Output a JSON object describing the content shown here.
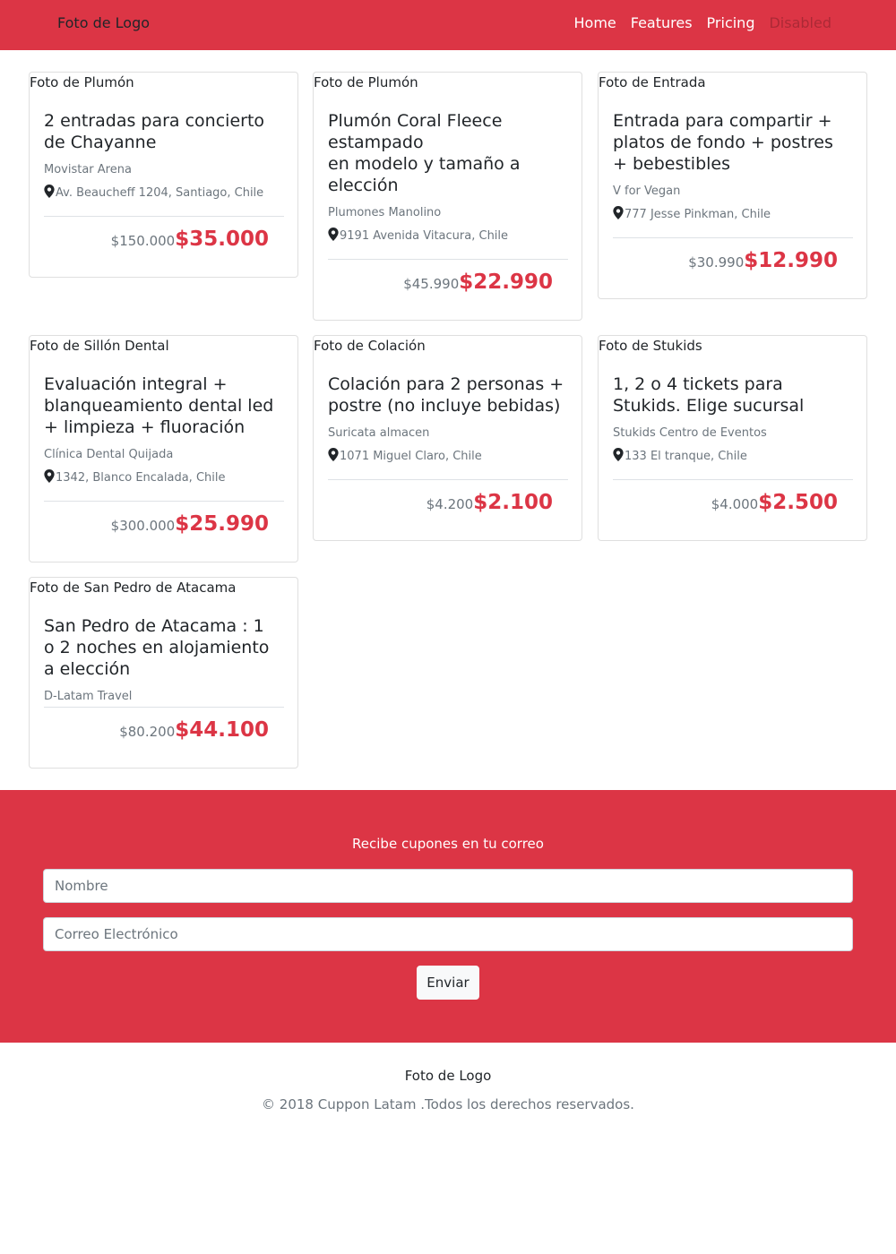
{
  "navbar": {
    "brand": "Foto de Logo",
    "links": [
      {
        "label": "Home"
      },
      {
        "label": "Features"
      },
      {
        "label": "Pricing"
      },
      {
        "label": "Disabled"
      }
    ]
  },
  "deals": [
    {
      "image_alt": "Foto de Plumón",
      "title": "2 entradas para concierto de Chayanne",
      "merchant": "Movistar Arena",
      "address": "Av. Beaucheff 1204, Santiago, Chile",
      "old_price": "$150.000",
      "new_price": "$35.000"
    },
    {
      "image_alt": "Foto de Plumón",
      "title": "Plumón Coral Fleece estampado\nen modelo y tamaño a elección",
      "merchant": "Plumones Manolino",
      "address": "9191 Avenida Vitacura, Chile",
      "old_price": "$45.990",
      "new_price": "$22.990"
    },
    {
      "image_alt": "Foto de Entrada",
      "title": "Entrada para compartir + platos de fondo + postres + bebestibles",
      "merchant": "V for Vegan",
      "address": "777 Jesse Pinkman, Chile",
      "old_price": "$30.990",
      "new_price": "$12.990"
    },
    {
      "image_alt": "Foto de Sillón Dental",
      "title": "Evaluación integral + blanqueamiento dental led + limpieza + fluoración",
      "merchant": "Clínica Dental Quijada",
      "address": "1342, Blanco Encalada, Chile",
      "old_price": "$300.000",
      "new_price": "$25.990"
    },
    {
      "image_alt": "Foto de Colación",
      "title": "Colación para 2 personas + postre (no incluye bebidas)",
      "merchant": "Suricata almacen",
      "address": "1071 Miguel Claro, Chile",
      "old_price": "$4.200",
      "new_price": "$2.100"
    },
    {
      "image_alt": "Foto de Stukids",
      "title": "1, 2 o 4 tickets para Stukids. Elige sucursal",
      "merchant": "Stukids Centro de Eventos",
      "address": "133 El tranque, Chile",
      "old_price": "$4.000",
      "new_price": "$2.500"
    },
    {
      "image_alt": "Foto de San Pedro de Atacama",
      "title": "San Pedro de Atacama : 1 o 2 noches en alojamiento a elección",
      "merchant": "D-Latam Travel",
      "old_price": "$80.200",
      "new_price": "$44.100"
    }
  ],
  "newsletter": {
    "heading": "Recibe cupones en tu correo",
    "name_placeholder": "Nombre",
    "email_placeholder": "Correo Electrónico",
    "submit_label": "Enviar"
  },
  "footer": {
    "logo": "Foto de Logo",
    "copyright": "© 2018 Cuppon Latam .Todos los derechos reservados."
  },
  "colors": {
    "brand_red": "#dc3545",
    "muted_text": "#6c757d"
  },
  "icons": {
    "address": "map-marker-icon"
  }
}
